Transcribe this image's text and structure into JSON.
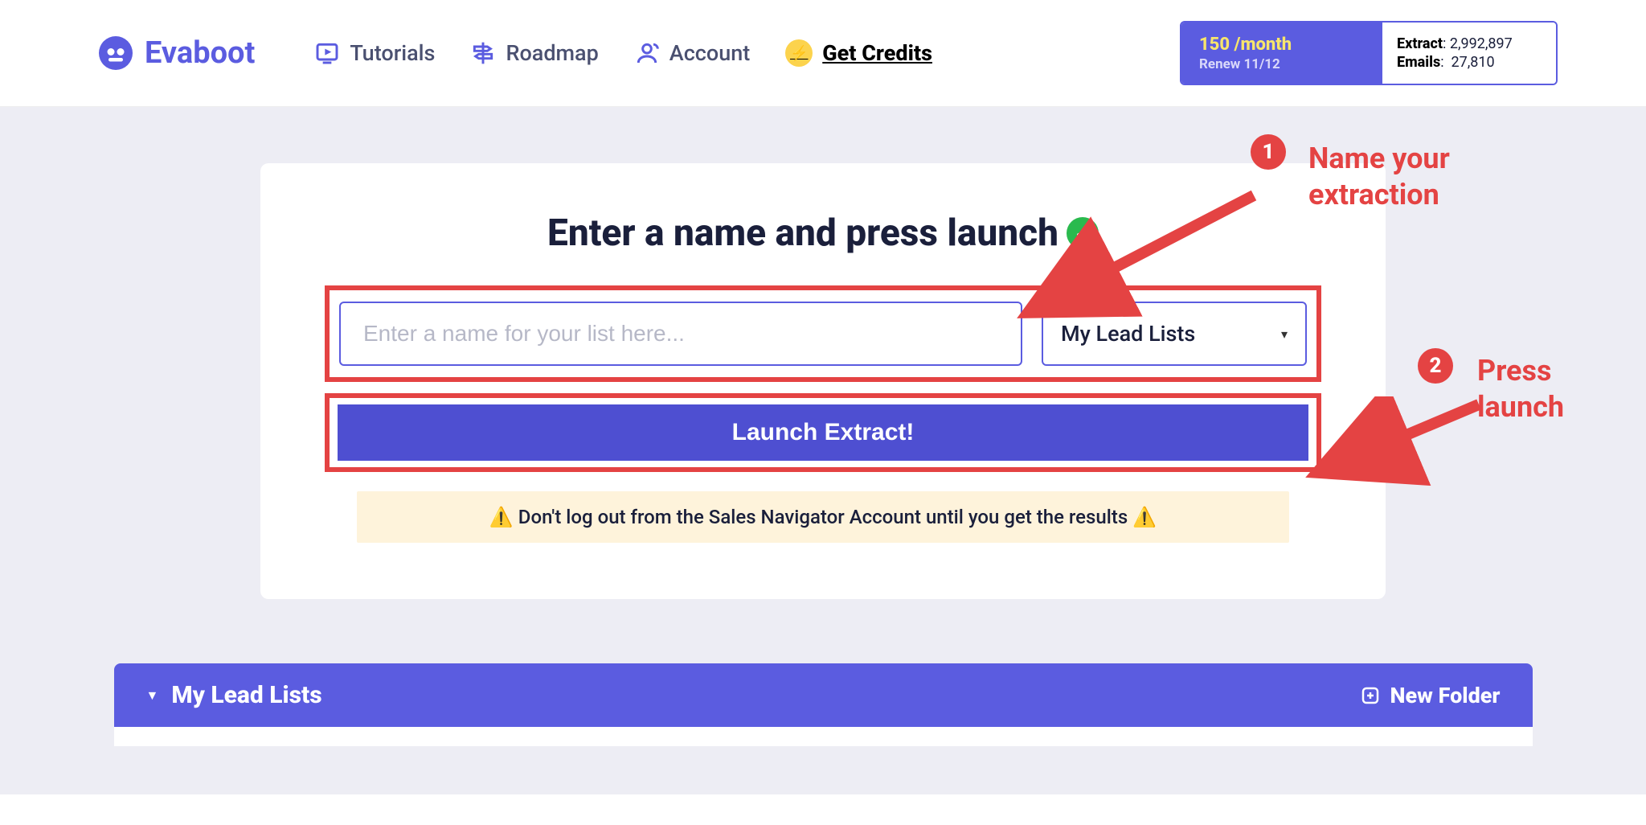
{
  "brand": {
    "name": "Evaboot"
  },
  "nav": {
    "tutorials": "Tutorials",
    "roadmap": "Roadmap",
    "account": "Account",
    "get_credits": "Get Credits"
  },
  "plan": {
    "quota": "150 /month",
    "renew": "Renew 11/12",
    "extract_label": "Extract",
    "extract_value": "2,992,897",
    "emails_label": "Emails",
    "emails_value": "27,810"
  },
  "card": {
    "title": "Enter a name and press launch",
    "name_placeholder": "Enter a name for your list here...",
    "select_value": "My Lead Lists",
    "launch_button": "Launch Extract!",
    "warning": "Don't log out from the Sales Navigator Account until you get the results"
  },
  "list_bar": {
    "title": "My Lead Lists",
    "new_folder": "New Folder"
  },
  "annotations": {
    "one": "1",
    "one_text_a": "Name your",
    "one_text_b": "extraction",
    "two": "2",
    "two_text_a": "Press",
    "two_text_b": "launch"
  }
}
